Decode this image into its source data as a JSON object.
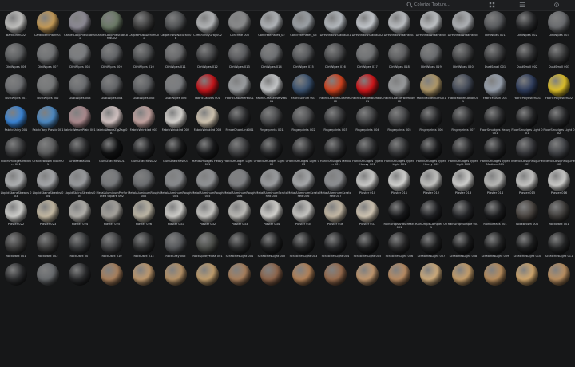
{
  "header": {
    "search_placeholder": "Colorize Texture..."
  },
  "items": [
    {
      "label": "BarkBirch002",
      "color": "#c4c4c2"
    },
    {
      "label": "CardboardPlain001",
      "color": "#c89d58"
    },
    {
      "label": "CarpetLoopPileStub001",
      "color": "#8e8b96"
    },
    {
      "label": "CarpetLoopPileStubCords002",
      "color": "#6b7a66"
    },
    {
      "label": "CarpetPlushDenim001",
      "color": "#3c3c3c"
    },
    {
      "label": "CarpetTwistNatural008",
      "color": "#505254"
    },
    {
      "label": "CliffChunkyGray002",
      "color": "#b6b8ba"
    },
    {
      "label": "Concrete 005",
      "color": "#8b8c8d"
    },
    {
      "label": "ConcretePlates_02",
      "color": "#b4b8bc"
    },
    {
      "label": "ConcretePlates_05",
      "color": "#9ea3a8"
    },
    {
      "label": "DirtWindowStains001",
      "color": "#b7bcc1"
    },
    {
      "label": "DirtWindowStains002",
      "color": "#c7cbd0"
    },
    {
      "label": "DirtWindowStains003",
      "color": "#bfc2c6"
    },
    {
      "label": "DirtWindowStains004",
      "color": "#c2c5c8"
    },
    {
      "label": "DirtWindowStains005",
      "color": "#b2b5b9"
    },
    {
      "label": "DirtWipes 001",
      "color": "#585a5d"
    },
    {
      "label": "DirtWipes 002",
      "color": "#2a2b2d"
    },
    {
      "label": "DirtWipes 003",
      "color": "#6a6c6f"
    },
    {
      "label": "DirtWipes 006",
      "color": "#5c5e60"
    },
    {
      "label": "DirtWipes 007",
      "color": "#707274"
    },
    {
      "label": "DirtWipes 008",
      "color": "#7b7d80"
    },
    {
      "label": "DirtWipes 009",
      "color": "#626467"
    },
    {
      "label": "DirtWipes 010",
      "color": "#4f5153"
    },
    {
      "label": "DirtWipes 011",
      "color": "#68696b"
    },
    {
      "label": "DirtWipes 012",
      "color": "#434446"
    },
    {
      "label": "DirtWipes 013",
      "color": "#5a5b5e"
    },
    {
      "label": "DirtWipes 014",
      "color": "#6e7073"
    },
    {
      "label": "DirtWipes 015",
      "color": "#56585b"
    },
    {
      "label": "DirtWipes 016",
      "color": "#4b4c4e"
    },
    {
      "label": "DirtWipes 017",
      "color": "#707274"
    },
    {
      "label": "DirtWipes 018",
      "color": "#5d5e60"
    },
    {
      "label": "DirtWipes 019",
      "color": "#6a6c6f"
    },
    {
      "label": "DirtWipes 020",
      "color": "#454648"
    },
    {
      "label": "DustSmall 001",
      "color": "#3e3f41"
    },
    {
      "label": "DustSmall 002",
      "color": "#303133"
    },
    {
      "label": "DustSmall 003",
      "color": "#373839"
    },
    {
      "label": "DustWipes 001",
      "color": "#6d6f72"
    },
    {
      "label": "DustWipes 002",
      "color": "#767879"
    },
    {
      "label": "DustWipes 003",
      "color": "#6b6d70"
    },
    {
      "label": "DustWipes 004",
      "color": "#626467"
    },
    {
      "label": "DustWipes 005",
      "color": "#5e6063"
    },
    {
      "label": "DustWipes 006",
      "color": "#7a7c7f"
    },
    {
      "label": "FabricCanvas 001",
      "color": "#c8151b"
    },
    {
      "label": "FabricCashmere001",
      "color": "#9da0a3"
    },
    {
      "label": "FabricCreasedVelvet001",
      "color": "#c9cbcd"
    },
    {
      "label": "FabricDenim 003",
      "color": "#3a5270"
    },
    {
      "label": "FabricLeatherCoarse002",
      "color": "#d2431f"
    },
    {
      "label": "FabricLeatherBuffalo001",
      "color": "#d3161a"
    },
    {
      "label": "FabricLeatherBuffalo002",
      "color": "#9a9c9e"
    },
    {
      "label": "FabricModelBurn001",
      "color": "#b29a6a"
    },
    {
      "label": "FabricModelCotton001",
      "color": "#434a58"
    },
    {
      "label": "FabricMuslin 001",
      "color": "#9aa3b0"
    },
    {
      "label": "FabricPolyester001",
      "color": "#2e3c5c"
    },
    {
      "label": "FabricPolyester002",
      "color": "#e1c22a"
    },
    {
      "label": "FabricShiny 001",
      "color": "#3b86d8"
    },
    {
      "label": "FabricTarp Plastic 001",
      "color": "#4d8ac4"
    },
    {
      "label": "FabricWeavePlaid 001",
      "color": "#ae8c90"
    },
    {
      "label": "FabricWeaveZigZag 001",
      "color": "#d7c7c6"
    },
    {
      "label": "FabricWrinkled 001",
      "color": "#c6a6a3"
    },
    {
      "label": "FabricWrinkled 002",
      "color": "#d9d6d2"
    },
    {
      "label": "FabricWrinkled 003",
      "color": "#d4c8b4"
    },
    {
      "label": "FenceChainLink001",
      "color": "#2e2f31"
    },
    {
      "label": "Fingerprints 001",
      "color": "#4a4b4d"
    },
    {
      "label": "Fingerprints 002",
      "color": "#505153"
    },
    {
      "label": "Fingerprints 003",
      "color": "#3a3b3d"
    },
    {
      "label": "Fingerprints 004",
      "color": "#404143"
    },
    {
      "label": "Fingerprints 005",
      "color": "#464749"
    },
    {
      "label": "Fingerprints 006",
      "color": "#2b2c2e"
    },
    {
      "label": "Fingerprints 007",
      "color": "#333436"
    },
    {
      "label": "FloorSmudges Heavy 001",
      "color": "#2d2e30"
    },
    {
      "label": "FloorSmudges Light 001",
      "color": "#262729"
    },
    {
      "label": "FloorSmudges Light 002",
      "color": "#2a2b2d"
    },
    {
      "label": "FloorSmudges Medium 001",
      "color": "#3a3b3d"
    },
    {
      "label": "GraniteBrown Floor001",
      "color": "#5b5c5d"
    },
    {
      "label": "GrateMetal001",
      "color": "#2c2d2f"
    },
    {
      "label": "GunScratches001",
      "color": "#111213"
    },
    {
      "label": "GunScratches002",
      "color": "#202123"
    },
    {
      "label": "GunScratches003",
      "color": "#1a1b1c"
    },
    {
      "label": "HandSmudges Heavy 001",
      "color": "#1b1c1e"
    },
    {
      "label": "HandSmudges Light 001",
      "color": "#3d3e40"
    },
    {
      "label": "HandSmudges Light 002",
      "color": "#27282a"
    },
    {
      "label": "HandSmudges Light 003",
      "color": "#303133"
    },
    {
      "label": "HandSmudges Medium 001",
      "color": "#2a2b2d"
    },
    {
      "label": "HandSmudges Typed Heavy 001",
      "color": "#2f3032"
    },
    {
      "label": "HandSmudges Typed Light 001",
      "color": "#333436"
    },
    {
      "label": "HandSmudges Typed Heavy 002",
      "color": "#1e1f21"
    },
    {
      "label": "HandSmudges Typed Light 002",
      "color": "#2c2d2f"
    },
    {
      "label": "HandSmudges Typed Medium 001",
      "color": "#242527"
    },
    {
      "label": "InteriorDesignRugOne 001",
      "color": "#35363a"
    },
    {
      "label": "InteriorDesignRugOne 002",
      "color": "#404246"
    },
    {
      "label": "LiquidStainsStreaks 003",
      "color": "#b2b4b6"
    },
    {
      "label": "LiquidStainsStreaks 004",
      "color": "#a8aaad"
    },
    {
      "label": "LiquidStainsStreaks 005",
      "color": "#9c9ea1"
    },
    {
      "label": "MetalAluminumPerforated Square 002",
      "color": "#77797c"
    },
    {
      "label": "MetalAluminumRough 002",
      "color": "#6c6e71"
    },
    {
      "label": "MetalAluminumRough 004",
      "color": "#8a8c8f"
    },
    {
      "label": "MetalAluminumRough 005",
      "color": "#939598"
    },
    {
      "label": "MetalAluminumRough 006",
      "color": "#7f8184"
    },
    {
      "label": "MetalAluminumScratched 005",
      "color": "#9ea0a3"
    },
    {
      "label": "MetalAluminumScratched 006",
      "color": "#a9abad"
    },
    {
      "label": "MetalAluminumScratched 007",
      "color": "#8f9194"
    },
    {
      "label": "Plaster 010",
      "color": "#cfcfcd"
    },
    {
      "label": "Plaster 011",
      "color": "#d8d8d6"
    },
    {
      "label": "Plaster 012",
      "color": "#c6c6c4"
    },
    {
      "label": "Plaster 013",
      "color": "#d3d3d1"
    },
    {
      "label": "Plaster 014",
      "color": "#bcbcba"
    },
    {
      "label": "Plaster 015",
      "color": "#c9c9c7"
    },
    {
      "label": "Plaster 016",
      "color": "#d0d0ce"
    },
    {
      "label": "Plaster 022",
      "color": "#d2d2cf"
    },
    {
      "label": "Plaster 023",
      "color": "#c8bda6"
    },
    {
      "label": "Plaster 024",
      "color": "#b4b2ad"
    },
    {
      "label": "Plaster 025",
      "color": "#a7a49e"
    },
    {
      "label": "Plaster 026",
      "color": "#c0b9a8"
    },
    {
      "label": "Plaster 031",
      "color": "#d2d1cd"
    },
    {
      "label": "Plaster 032",
      "color": "#c9c8c4"
    },
    {
      "label": "Plaster 033",
      "color": "#bfbeba"
    },
    {
      "label": "Plaster 034",
      "color": "#d6d5d1"
    },
    {
      "label": "Plaster 035",
      "color": "#cac9c5"
    },
    {
      "label": "Plaster 036",
      "color": "#c8bca8"
    },
    {
      "label": "Plaster 037",
      "color": "#d4c9b6"
    },
    {
      "label": "RainDropsAndStreaks 001",
      "color": "#1a1b1d"
    },
    {
      "label": "RainDropsComplex 001",
      "color": "#202124"
    },
    {
      "label": "RainDropsSimple 001",
      "color": "#26272a"
    },
    {
      "label": "RainStreaks 001",
      "color": "#1d1e20"
    },
    {
      "label": "RockBrown 004",
      "color": "#4a4541"
    },
    {
      "label": "RockDark 001",
      "color": "#3f3d3b"
    },
    {
      "label": "RockDark 001",
      "color": "#3c3c3c"
    },
    {
      "label": "RockDark 002",
      "color": "#3a3a3a"
    },
    {
      "label": "RockDark 007",
      "color": "#353739"
    },
    {
      "label": "RockDark 010",
      "color": "#3f4042"
    },
    {
      "label": "RockDark 013",
      "color": "#2f3031"
    },
    {
      "label": "RockGray 005",
      "color": "#55575a"
    },
    {
      "label": "RockSpottyMoss 001",
      "color": "#4a4c48"
    },
    {
      "label": "ScratchesLight 001",
      "color": "#2a2b2c"
    },
    {
      "label": "ScratchesLight 002",
      "color": "#1f2021"
    },
    {
      "label": "ScratchesLight 003",
      "color": "#232425"
    },
    {
      "label": "ScratchesLight 004",
      "color": "#262729"
    },
    {
      "label": "ScratchesLight 005",
      "color": "#1d1e1f"
    },
    {
      "label": "ScratchesLight 006",
      "color": "#29292a"
    },
    {
      "label": "ScratchesLight 007",
      "color": "#202122"
    },
    {
      "label": "ScratchesLight 008",
      "color": "#1c1d1e"
    },
    {
      "label": "ScratchesLight 009",
      "color": "#232425"
    },
    {
      "label": "ScratchesLight 010",
      "color": "#1e1f20"
    },
    {
      "label": "ScratchesLight 011",
      "color": "#252627"
    },
    {
      "label": "",
      "color": "#2d2e30"
    },
    {
      "label": "",
      "color": "#676a6d"
    },
    {
      "label": "",
      "color": "#2b2c2e"
    },
    {
      "label": "",
      "color": "#aa815d"
    },
    {
      "label": "",
      "color": "#c09a6f"
    },
    {
      "label": "",
      "color": "#b89469"
    },
    {
      "label": "",
      "color": "#c3a06f"
    },
    {
      "label": "",
      "color": "#a9805d"
    },
    {
      "label": "",
      "color": "#8f664c"
    },
    {
      "label": "",
      "color": "#b48359"
    },
    {
      "label": "",
      "color": "#986c4e"
    },
    {
      "label": "",
      "color": "#c39970"
    },
    {
      "label": "",
      "color": "#ba8d64"
    },
    {
      "label": "",
      "color": "#d0ad7d"
    },
    {
      "label": "",
      "color": "#c8a06c"
    },
    {
      "label": "",
      "color": "#b98e5e"
    },
    {
      "label": "",
      "color": "#d2a86e"
    },
    {
      "label": "",
      "color": "#bc9162"
    }
  ]
}
